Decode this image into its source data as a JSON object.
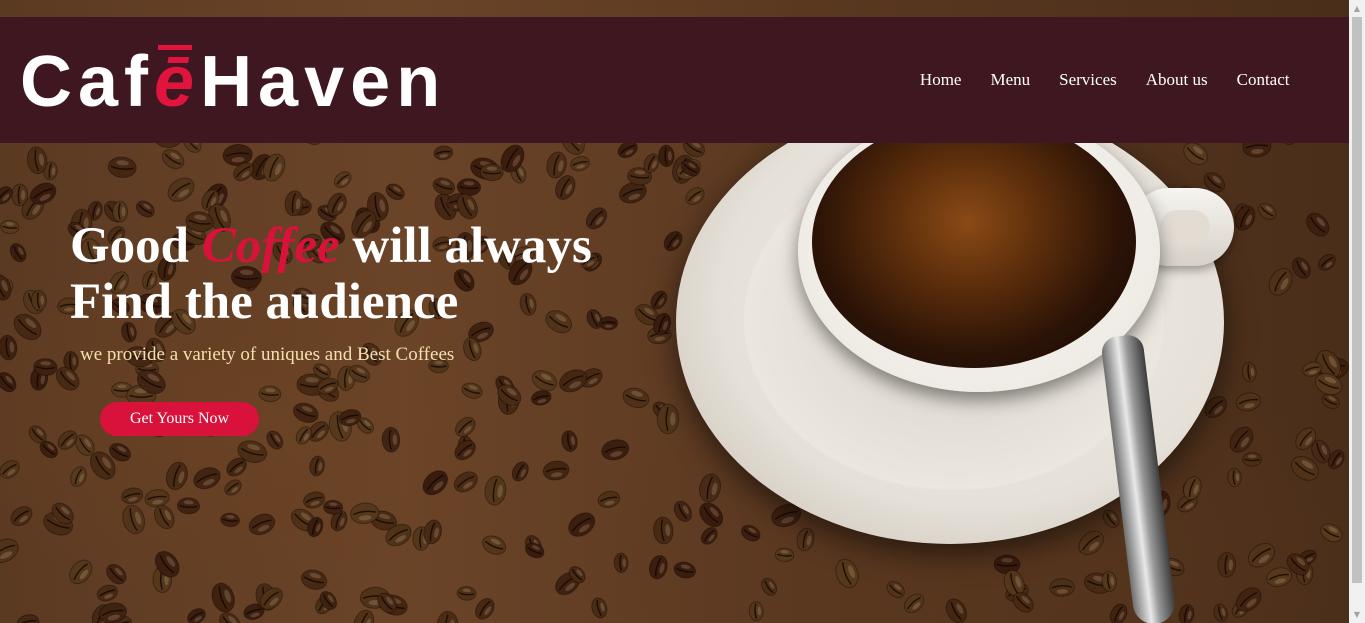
{
  "brand": {
    "name_part1": "Caf",
    "name_accent": "ē",
    "name_part2": "Haven",
    "primary_color": "#3e1720",
    "accent_color": "#d8123b"
  },
  "nav": {
    "items": [
      {
        "label": "Home"
      },
      {
        "label": "Menu"
      },
      {
        "label": "Services"
      },
      {
        "label": "About us"
      },
      {
        "label": "Contact"
      }
    ]
  },
  "hero": {
    "line1_pre": "Good ",
    "line1_highlight": "Coffee",
    "line1_post": " will always",
    "line2": "Find the audience",
    "subtitle": "we provide a variety of uniques and Best Coffees",
    "cta_label": "Get Yours Now"
  },
  "icons": {
    "scroll_up": "triangle-up-icon",
    "scroll_down": "triangle-down-icon"
  }
}
